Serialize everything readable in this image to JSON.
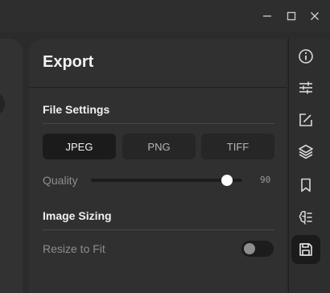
{
  "window": {
    "minimize_icon": "minimize-icon",
    "maximize_icon": "maximize-icon",
    "close_icon": "close-icon"
  },
  "export": {
    "title": "Export",
    "file_settings": {
      "title": "File Settings",
      "formats": [
        "JPEG",
        "PNG",
        "TIFF"
      ],
      "selected_format": "JPEG",
      "quality_label": "Quality",
      "quality_value": "90",
      "quality_level": 0.9
    },
    "image_sizing": {
      "title": "Image Sizing",
      "resize_label": "Resize to Fit",
      "resize_enabled": false
    }
  },
  "rail": {
    "items": [
      "info-icon",
      "sliders-icon",
      "export-arrow-icon",
      "layers-icon",
      "bookmark-icon",
      "brain-icon",
      "save-icon"
    ],
    "active": "save-icon"
  },
  "colors": {
    "background": "#2b2b2b",
    "panel": "#303030",
    "active_button": "#1b1b1b",
    "thumb": "#ffffff"
  }
}
